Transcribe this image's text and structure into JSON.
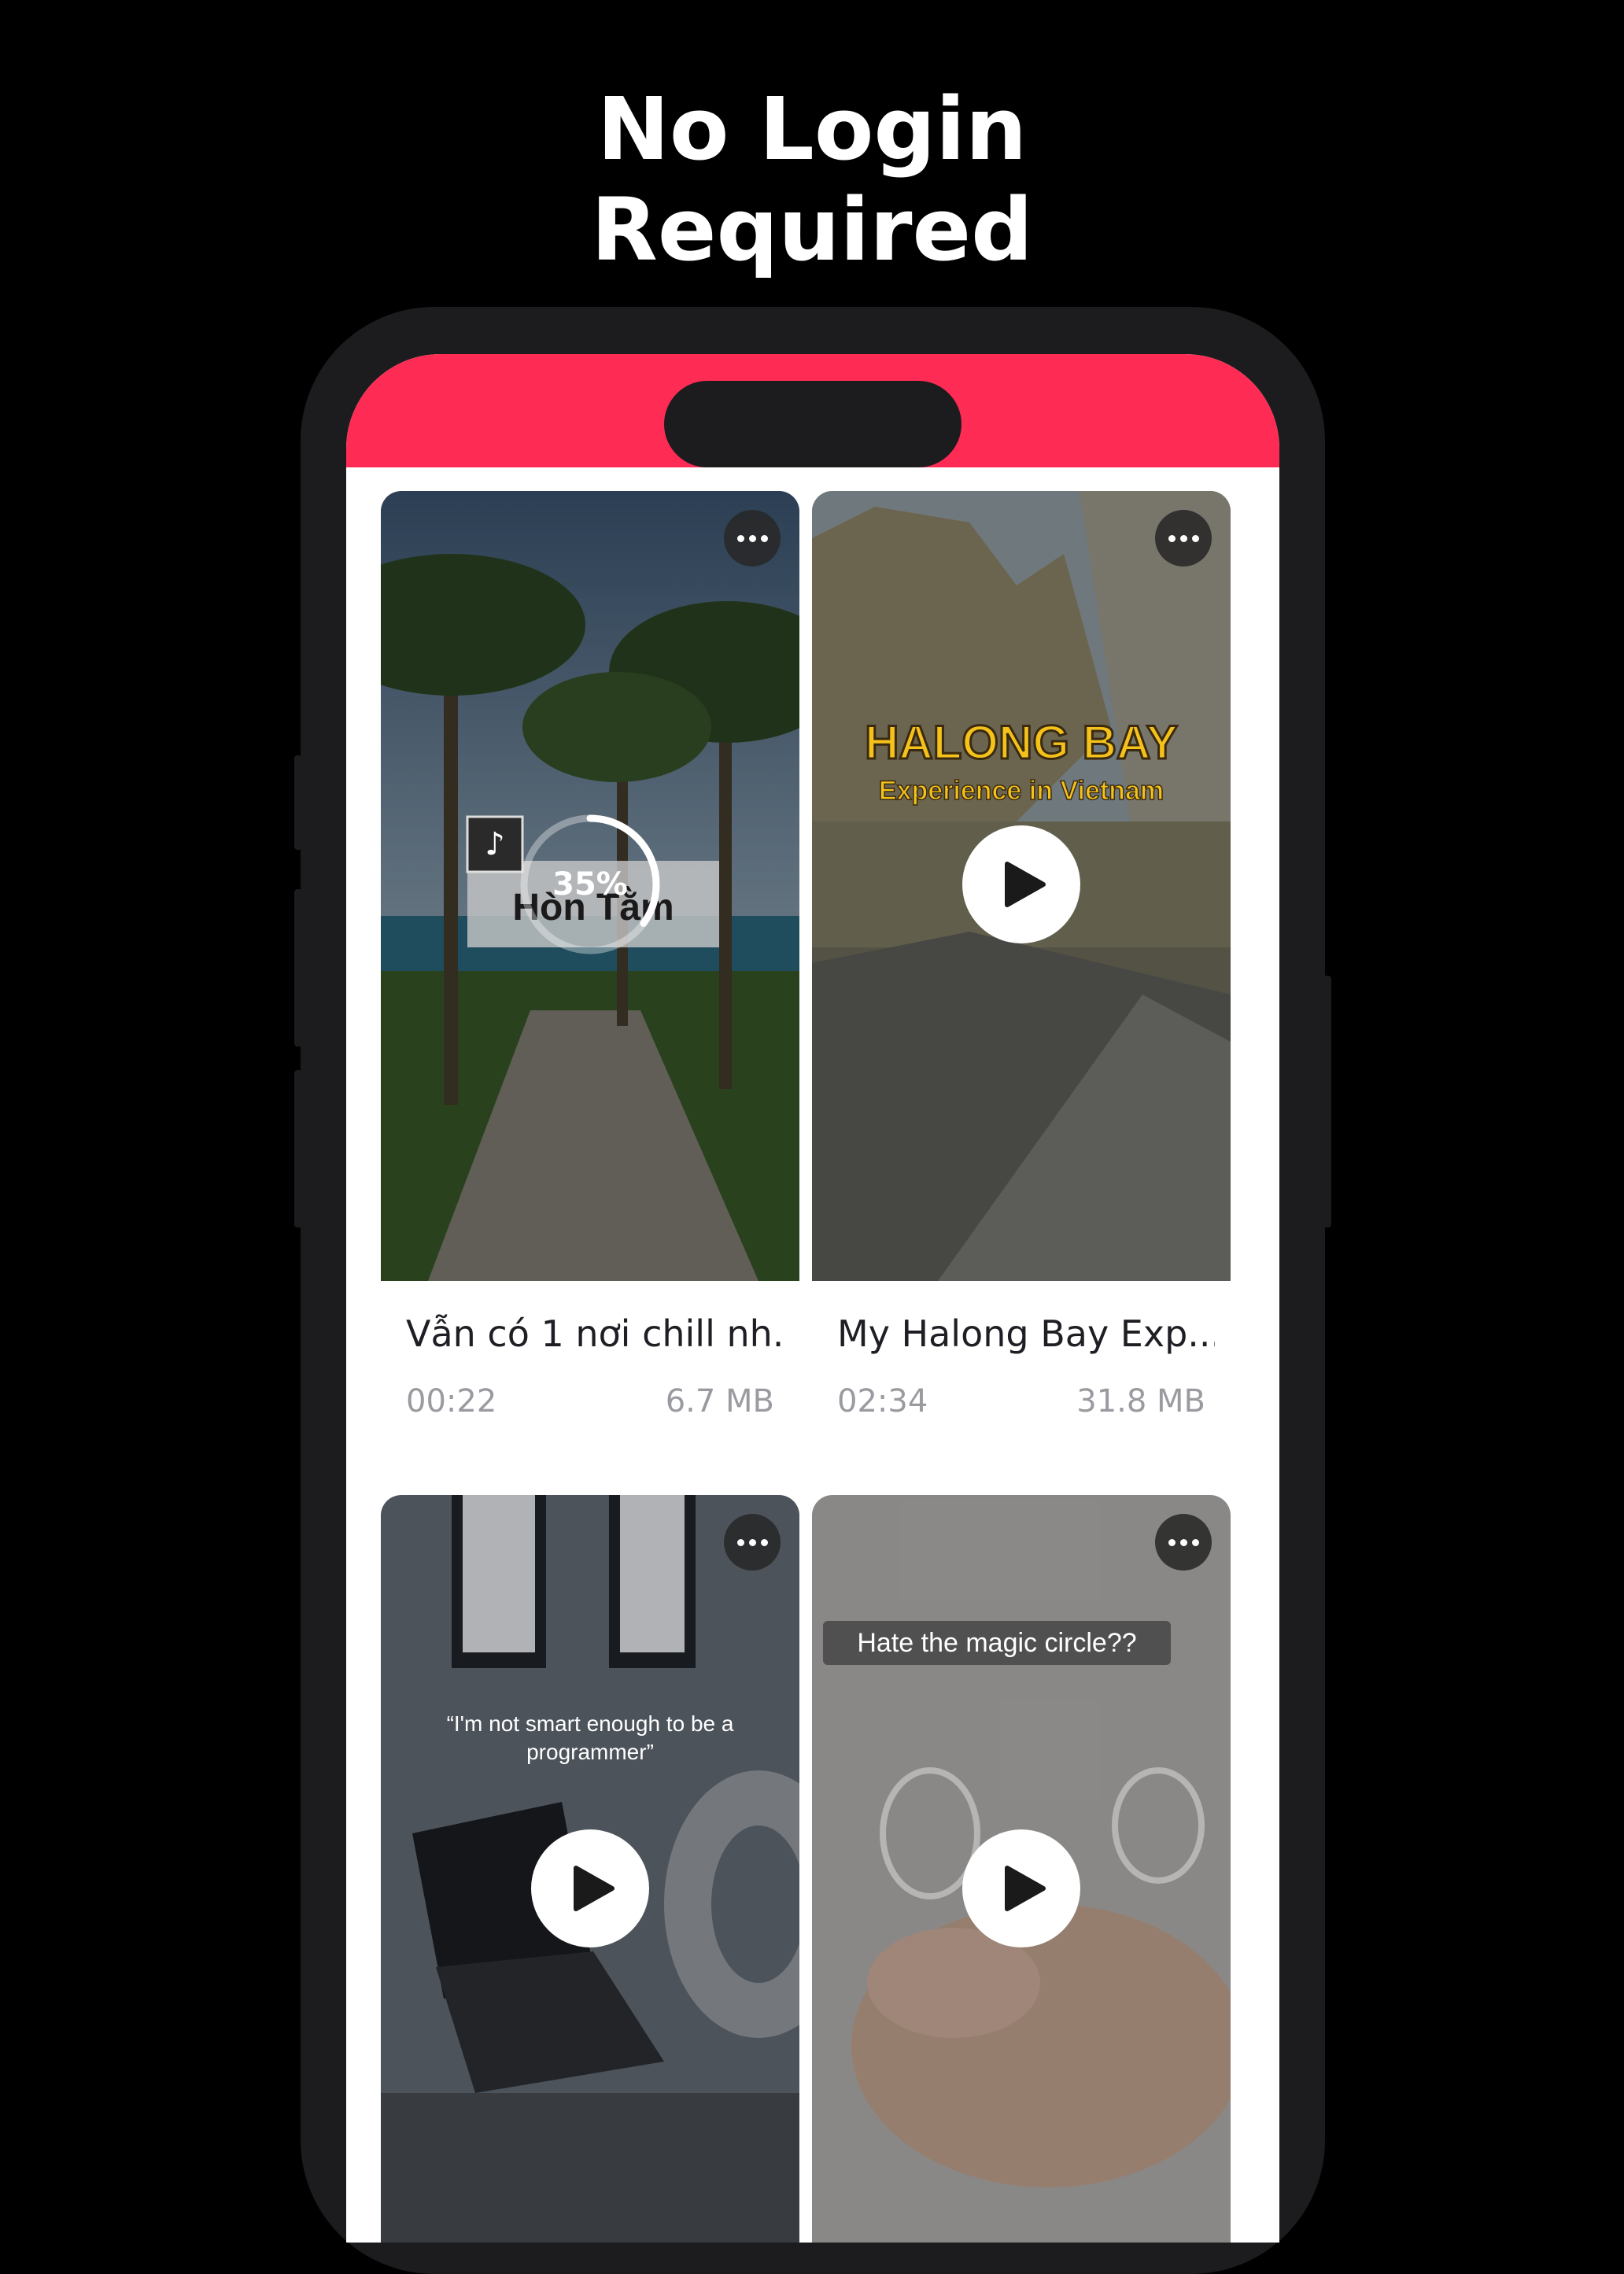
{
  "headline": {
    "line1": "No Login",
    "line2": "Required"
  },
  "colors": {
    "status_bar": "#fe2c55",
    "background": "#000000",
    "card_bg": "#ffffff"
  },
  "videos": [
    {
      "title": "Vẫn có 1 nơi chill nh...",
      "duration": "00:22",
      "size": "6.7 MB",
      "state": "downloading",
      "progress_label": "35%",
      "progress": 0.35,
      "overlay_text": "Hòn Tằm",
      "icons": [
        "more-icon",
        "tiktok-logo-icon"
      ]
    },
    {
      "title": "My Halong Bay Exp...",
      "duration": "02:34",
      "size": "31.8 MB",
      "state": "ready",
      "overlay_title": "HALONG BAY",
      "overlay_subtitle": "Experience in Vietnam",
      "icons": [
        "more-icon",
        "play-icon"
      ]
    },
    {
      "title": "",
      "state": "ready",
      "overlay_text": "“I'm not smart enough to be a programmer”",
      "overlay_line1": "“I'm not smart enough to be a",
      "overlay_line2": "programmer”",
      "icons": [
        "more-icon",
        "play-icon"
      ]
    },
    {
      "title": "",
      "state": "ready",
      "overlay_text": "Hate the magic circle??",
      "icons": [
        "more-icon",
        "play-icon"
      ]
    }
  ]
}
